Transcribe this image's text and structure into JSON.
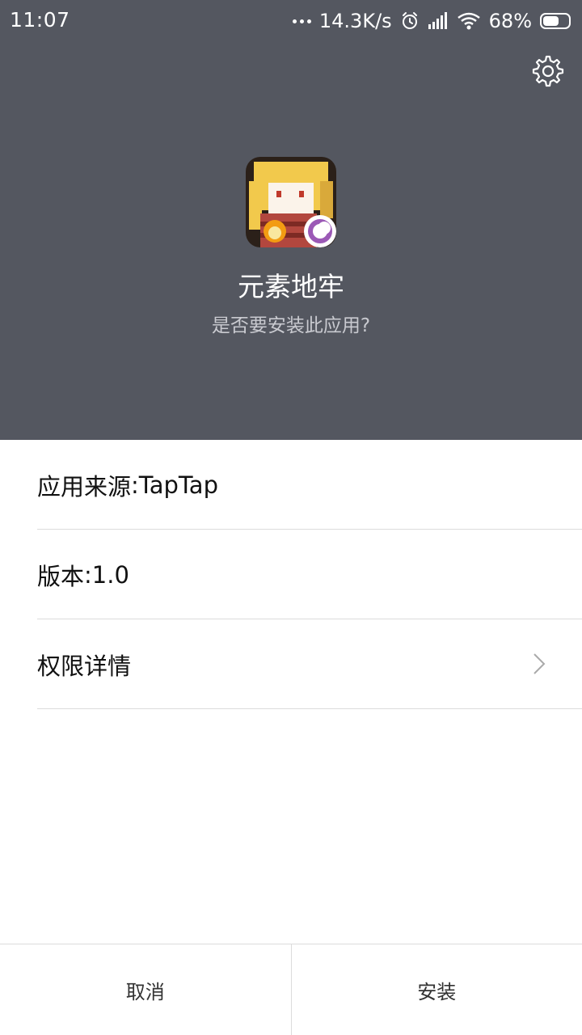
{
  "status_bar": {
    "time": "11:07",
    "network_speed": "14.3K/s",
    "battery_percent": "68%",
    "battery_level": 0.68,
    "icons": [
      "more-dots-icon",
      "alarm-icon",
      "signal-icon",
      "wifi-icon",
      "battery-icon"
    ]
  },
  "header": {
    "settings_icon": "gear-icon",
    "app_icon": "app-icon",
    "app_name": "元素地牢",
    "prompt": "是否要安装此应用?",
    "background_color": "#545760"
  },
  "details": {
    "source_label": "应用来源",
    "source_value": "TapTap",
    "version_label": "版本",
    "version_value": "1.0",
    "permissions_label": "权限详情",
    "permissions_icon": "chevron-right-icon"
  },
  "actions": {
    "cancel_label": "取消",
    "install_label": "安装"
  }
}
